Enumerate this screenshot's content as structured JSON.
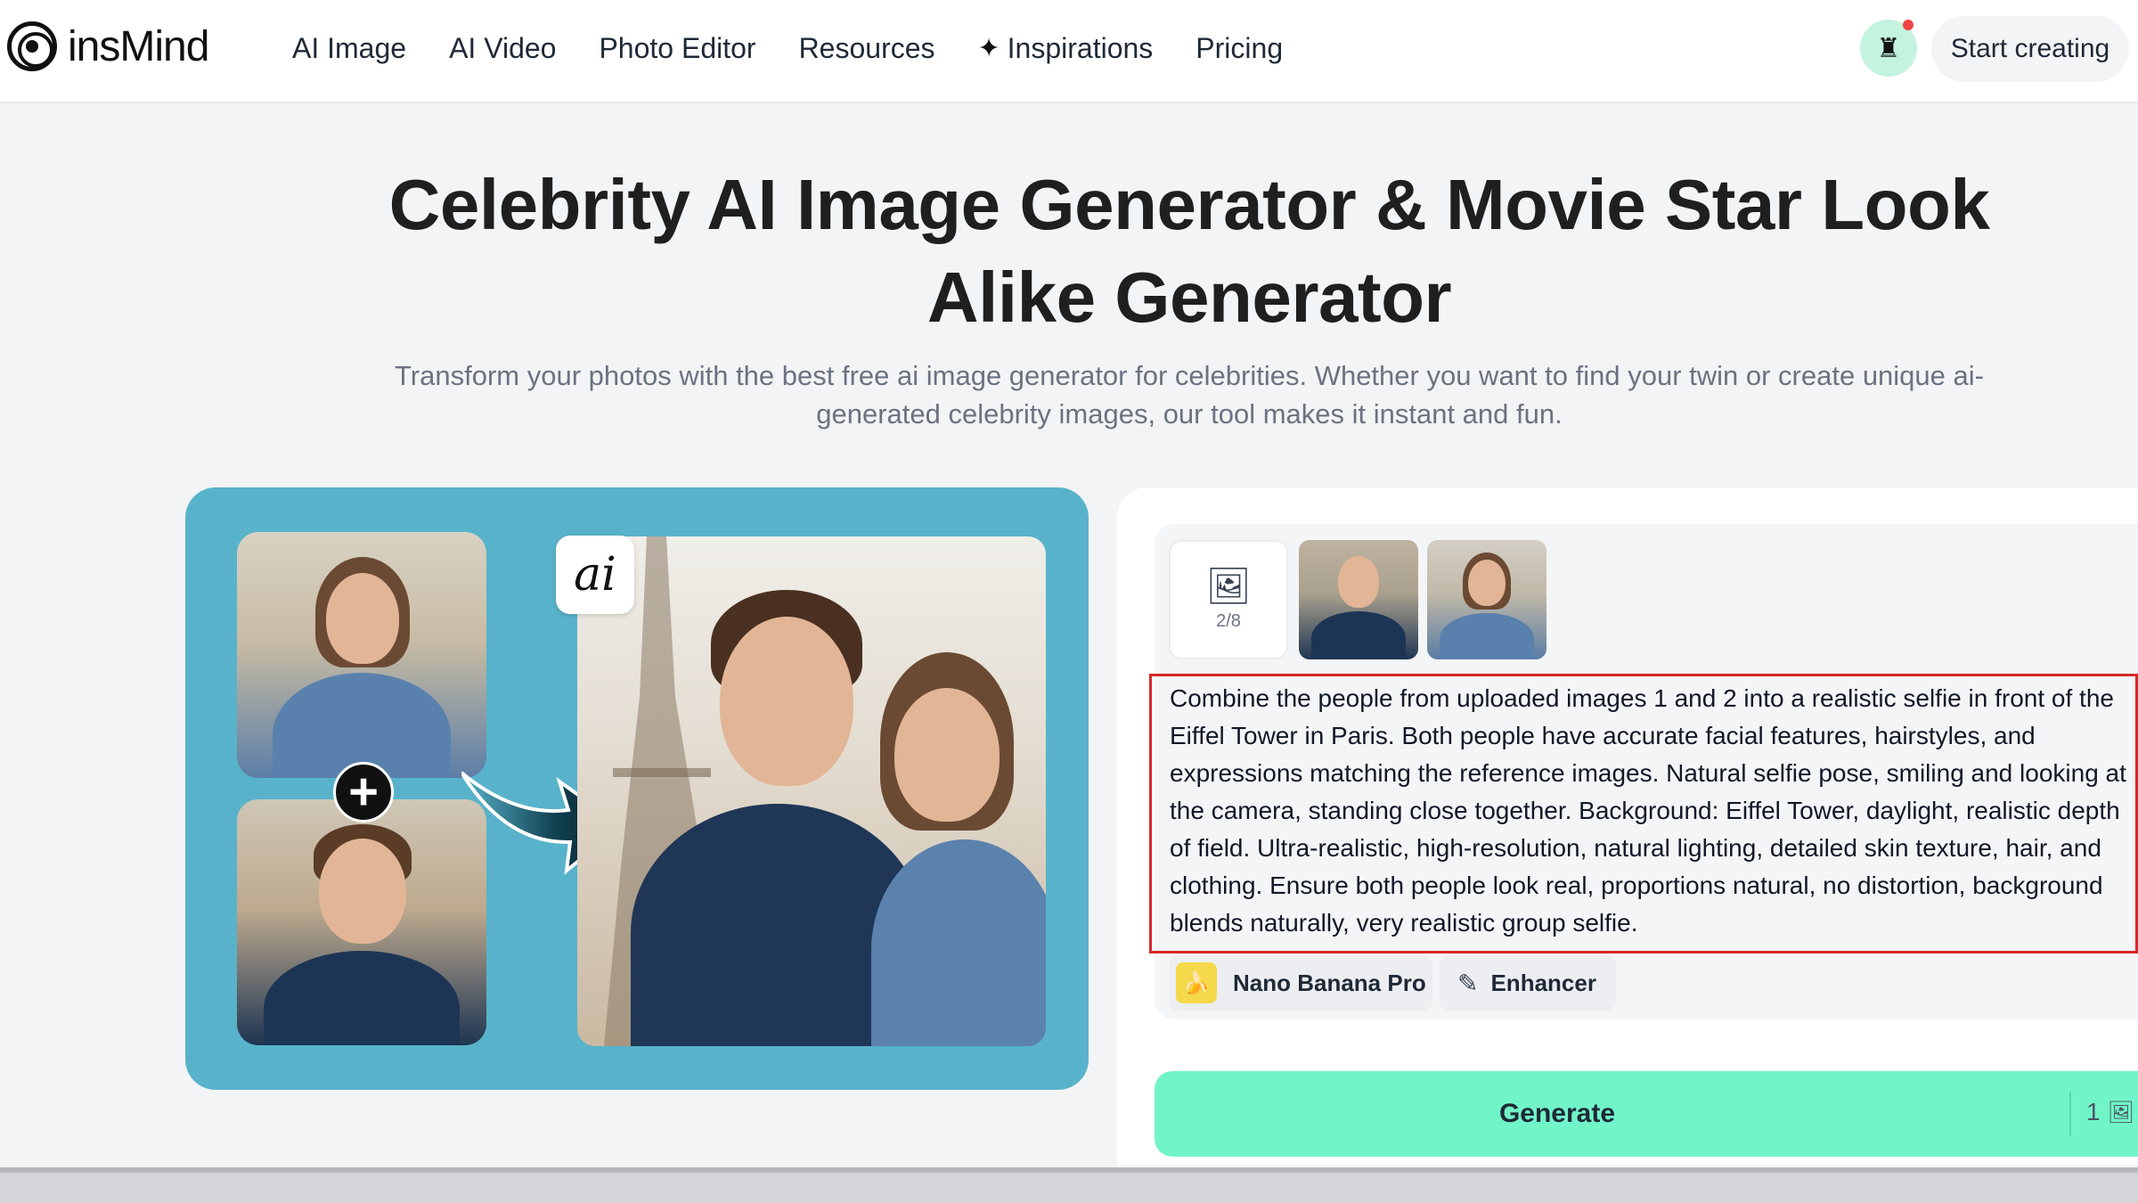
{
  "header": {
    "logo_text": "insMind",
    "nav": [
      {
        "label": "AI Image"
      },
      {
        "label": "AI Video"
      },
      {
        "label": "Photo Editor"
      },
      {
        "label": "Resources"
      },
      {
        "label": "Inspirations",
        "icon": "sparkle-icon"
      },
      {
        "label": "Pricing"
      }
    ],
    "start_button": "Start creating"
  },
  "hero": {
    "title": "Celebrity AI Image Generator & Movie Star Look Alike Generator",
    "subtitle": "Transform your photos with the best free ai image generator for celebrities. Whether you want to find your twin or create unique ai-generated celebrity images, our tool makes it instant and fun."
  },
  "editor": {
    "upload_count": "2/8",
    "prompt": "Combine the people from uploaded images 1 and 2 into a realistic selfie in front of the Eiffel Tower in Paris. Both people have accurate facial features, hairstyles, and expressions matching the reference images. Natural selfie pose, smiling and looking at the camera, standing close together. Background: Eiffel Tower, daylight, realistic depth of field. Ultra-realistic, high-resolution, natural lighting, detailed skin texture, hair, and clothing. Ensure both people look real, proportions natural, no distortion, background blends naturally, very realistic group selfie.",
    "model_label": "Nano Banana Pro",
    "enhancer_label": "Enhancer",
    "generate_label": "Generate",
    "credit": "1"
  },
  "colors": {
    "accent_generate": "#71f5c8",
    "preview_bg": "#58b3ca",
    "highlight_border": "#d62828"
  }
}
